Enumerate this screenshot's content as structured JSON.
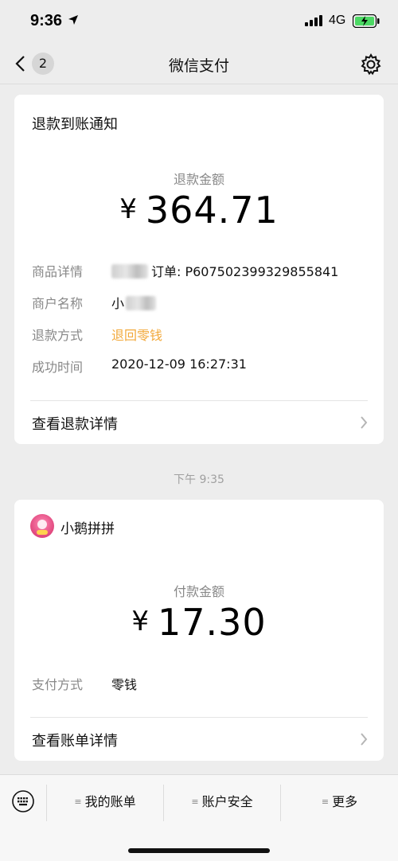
{
  "status_bar": {
    "time": "9:36",
    "network": "4G"
  },
  "nav": {
    "back_badge": "2",
    "title": "微信支付"
  },
  "refund_card": {
    "title": "退款到账通知",
    "amount_label": "退款金额",
    "currency": "¥",
    "amount": "364.71",
    "rows": [
      {
        "label": "商品详情",
        "value": "订单: P607502399329855841"
      },
      {
        "label": "商户名称",
        "value": "小"
      },
      {
        "label": "退款方式",
        "value": "退回零钱"
      },
      {
        "label": "成功时间",
        "value": "2020-12-09 16:27:31"
      }
    ],
    "detail_link": "查看退款详情"
  },
  "timestamp": "下午 9:35",
  "payment_card": {
    "merchant": "小鹅拼拼",
    "amount_label": "付款金额",
    "currency": "¥",
    "amount": "17.30",
    "rows": [
      {
        "label": "支付方式",
        "value": "零钱"
      }
    ],
    "detail_link": "查看账单详情"
  },
  "bottom_menu": {
    "items": [
      "我的账单",
      "账户安全",
      "更多"
    ]
  },
  "colors": {
    "accent_orange": "#f2a93b",
    "background": "#ededed"
  }
}
